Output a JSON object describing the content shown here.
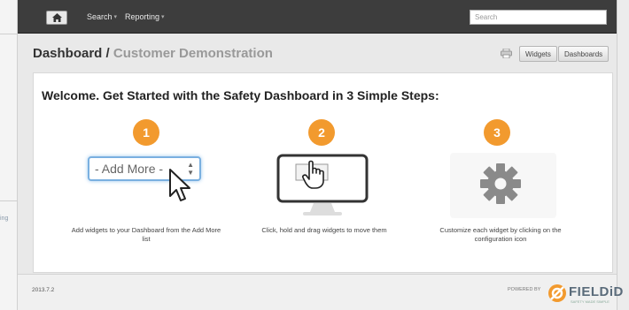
{
  "nav": {
    "search_menu": "Search",
    "reporting_menu": "Reporting",
    "search_placeholder": "Search"
  },
  "header": {
    "title": "Dashboard",
    "separator": "/",
    "subtitle": "Customer Demonstration",
    "widgets_button": "Widgets",
    "dashboards_button": "Dashboards"
  },
  "welcome": {
    "heading": "Welcome. Get Started with the Safety Dashboard in 3 Simple Steps:",
    "steps": [
      {
        "number": "1",
        "select_label": "- Add More -",
        "text": "Add widgets to your Dashboard from the Add More list"
      },
      {
        "number": "2",
        "text": "Click, hold and drag widgets to move them"
      },
      {
        "number": "3",
        "text": "Customize each widget by clicking on the configuration icon"
      }
    ]
  },
  "footer": {
    "version": "2013.7.2",
    "powered_by": "POWERED BY",
    "logo_text": "FIELDiD",
    "logo_tagline": "SAFETY MADE SIMPLE"
  },
  "left_fragment": "ing",
  "colors": {
    "nav_bg": "#3d3d3d",
    "badge": "#f29a2e",
    "select_border": "#7ab0e0"
  },
  "icons": [
    "home-icon",
    "print-icon",
    "cursor-icon",
    "hand-cursor-icon",
    "gear-icon"
  ]
}
